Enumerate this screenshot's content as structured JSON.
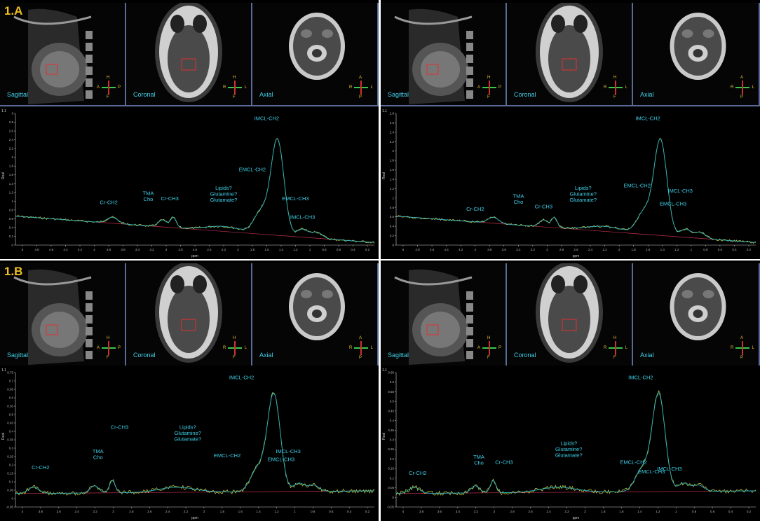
{
  "panels": [
    {
      "tag": "1.A",
      "left": {
        "views": [
          "Sagittal",
          "Coronal",
          "Axial"
        ],
        "orient": [
          [
            "H",
            "F",
            "A",
            "P"
          ],
          [
            "H",
            "F",
            "R",
            "L"
          ],
          [
            "A",
            "P",
            "R",
            "L"
          ]
        ],
        "spectrum": {
          "corner": "1.1",
          "ylabel": "Real",
          "xlabel": "ppm",
          "yticks": [
            "3",
            "2.8",
            "2.6",
            "2.4",
            "2.2",
            "2",
            "1.8",
            "1.6",
            "1.4",
            "1.2",
            "1",
            "0.8",
            "0.6",
            "0.4",
            "0.2",
            "0"
          ],
          "xticks": [
            "5",
            "4.8",
            "4.6",
            "4.4",
            "4.2",
            "4",
            "3.8",
            "3.6",
            "3.4",
            "3.2",
            "3",
            "2.8",
            "2.6",
            "2.4",
            "2.2",
            "2",
            "1.8",
            "1.6",
            "1.4",
            "1.2",
            "1",
            "0.8",
            "0.6",
            "0.4",
            "0.2"
          ],
          "peaks": [
            "Cr-CH2",
            "TMA\nCho",
            "Cr-CH3",
            "Lipids?\nGlutamine?\nGlutamate?",
            "IMCL-CH2",
            "EMCL-CH2",
            "EMCL-CH3",
            "IMCL-CH3"
          ]
        }
      },
      "right": {
        "views": [
          "Sagittal",
          "Coronal",
          "Axial"
        ],
        "orient": [
          [
            "H",
            "F",
            "A",
            "P"
          ],
          [
            "H",
            "F",
            "R",
            "L"
          ],
          [
            "A",
            "P",
            "R",
            "L"
          ]
        ],
        "spectrum": {
          "corner": "1.1",
          "ylabel": "Real",
          "xlabel": "ppm",
          "yticks": [
            "2.8",
            "2.6",
            "2.4",
            "2.2",
            "2",
            "1.8",
            "1.6",
            "1.4",
            "1.2",
            "1",
            "0.8",
            "0.6",
            "0.4",
            "0.2",
            "0"
          ],
          "xticks": [
            "5",
            "4.8",
            "4.6",
            "4.4",
            "4.2",
            "4",
            "3.8",
            "3.6",
            "3.4",
            "3.2",
            "3",
            "2.8",
            "2.6",
            "2.4",
            "2.2",
            "2",
            "1.8",
            "1.6",
            "1.4",
            "1.2",
            "1",
            "0.8",
            "0.6",
            "0.4",
            "0.2"
          ],
          "peaks": [
            "Cr-CH2",
            "TMA\nCho",
            "Cr-CH3",
            "Lipids?\nGlutamine?\nGlutamate?",
            "IMCL-CH2",
            "EMCL-CH2",
            "IMCL-CH3",
            "EMCL-CH3"
          ]
        }
      }
    },
    {
      "tag": "1.B",
      "left": {
        "views": [
          "Sagittal",
          "Coronal",
          "Axial"
        ],
        "orient": [
          [
            "H",
            "F",
            "A",
            "P"
          ],
          [
            "H",
            "F",
            "R",
            "L"
          ],
          [
            "A",
            "P",
            "R",
            "L"
          ]
        ],
        "spectrum": {
          "corner": "1.1",
          "ylabel": "Real",
          "xlabel": "ppm",
          "yticks": [
            "0.75",
            "0.7",
            "0.65",
            "0.6",
            "0.55",
            "0.5",
            "0.45",
            "0.4",
            "0.35",
            "0.3",
            "0.25",
            "0.2",
            "0.15",
            "0.1",
            "0.05",
            "0",
            "-0.05"
          ],
          "xticks": [
            "4",
            "3.8",
            "3.6",
            "3.4",
            "3.2",
            "3",
            "2.8",
            "2.6",
            "2.4",
            "2.2",
            "2",
            "1.8",
            "1.6",
            "1.4",
            "1.2",
            "1",
            "0.8",
            "0.6",
            "0.4",
            "0.2"
          ],
          "peaks": [
            "Cr-CH2",
            "TMA\nCho",
            "Cr-CH3",
            "Lipids?\nGlutamine?\nGlutamate?",
            "IMCL-CH2",
            "EMCL-CH2",
            "IMCL-CH3",
            "EMCL-CH3"
          ]
        }
      },
      "right": {
        "views": [
          "Sagittal",
          "Coronal",
          "Axial"
        ],
        "orient": [
          [
            "H",
            "F",
            "A",
            "P"
          ],
          [
            "H",
            "F",
            "R",
            "L"
          ],
          [
            "A",
            "P",
            "R",
            "L"
          ]
        ],
        "spectrum": {
          "corner": "1.1",
          "ylabel": "Real",
          "xlabel": "ppm",
          "yticks": [
            "0.65",
            "0.6",
            "0.55",
            "0.5",
            "0.45",
            "0.4",
            "0.35",
            "0.3",
            "0.25",
            "0.2",
            "0.15",
            "0.1",
            "0.05",
            "0",
            "-0.05"
          ],
          "xticks": [
            "4",
            "3.8",
            "3.6",
            "3.4",
            "3.2",
            "3",
            "2.8",
            "2.6",
            "2.4",
            "2.2",
            "2",
            "1.8",
            "1.6",
            "1.4",
            "1.2",
            "1",
            "0.8",
            "0.6",
            "0.4",
            "0.2"
          ],
          "peaks": [
            "Cr-CH2",
            "TMA\nCho",
            "Cr-CH3",
            "Lipids?\nGlutamine?\nGlutamate?",
            "IMCL-CH2",
            "EMCL-CH2",
            "EMCL-CH3",
            "IMCL-CH3"
          ]
        }
      }
    }
  ],
  "colors": {
    "label": "#3fd0e8",
    "tag": "#f0c020",
    "fit": "#2bb0c0",
    "raw": "#c8d640",
    "baseline": "#c03050",
    "axis": "#cfcfcf"
  }
}
